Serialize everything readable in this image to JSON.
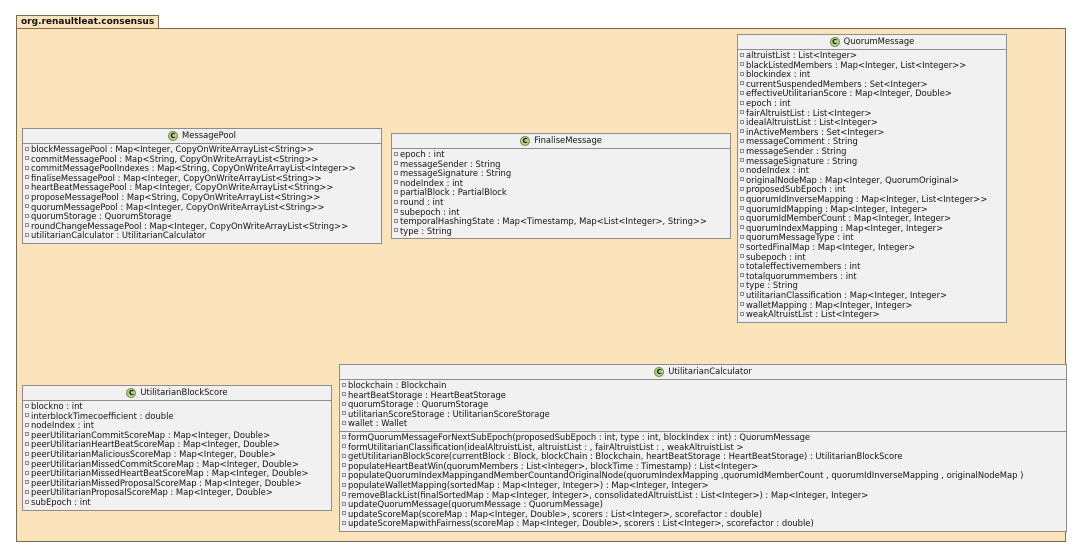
{
  "package": {
    "name": "org.renaultleat.consensus"
  },
  "classes": {
    "messagePool": {
      "stereotype": "C",
      "name": "MessagePool",
      "fields": [
        "blockMessagePool : Map<Integer, CopyOnWriteArrayList<String>>",
        "commitMessagePool : Map<String, CopyOnWriteArrayList<String>>",
        "commitMessagePoolIndexes : Map<String, CopyOnWriteArrayList<Integer>>",
        "finaliseMessagePool : Map<Integer, CopyOnWriteArrayList<String>>",
        "heartBeatMessagePool : Map<Integer, CopyOnWriteArrayList<String>>",
        "proposeMessagePool : Map<String, CopyOnWriteArrayList<String>>",
        "quorumMessagePool : Map<Integer, CopyOnWriteArrayList<String>>",
        "quorumStorage : QuorumStorage",
        "roundChangeMessagePool : Map<Integer, CopyOnWriteArrayList<String>>",
        "utilitarianCalculator : UtilitarianCalculator"
      ]
    },
    "finaliseMessage": {
      "stereotype": "C",
      "name": "FinaliseMessage",
      "fields": [
        "epoch : int",
        "messageSender : String",
        "messageSignature : String",
        "nodeIndex : int",
        "partialBlock : PartialBlock",
        "round : int",
        "subepoch : int",
        "temporalHashingState : Map<Timestamp, Map<List<Integer>, String>>",
        "type : String"
      ]
    },
    "quorumMessage": {
      "stereotype": "C",
      "name": "QuorumMessage",
      "fields": [
        "altruistList : List<Integer>",
        "blackListedMembers : Map<Integer, List<Integer>>",
        "blockindex : int",
        "currentSuspendedMembers : Set<Integer>",
        "effectiveUtilitarianScore : Map<Integer, Double>",
        "epoch : int",
        "fairAltruistList : List<Integer>",
        "idealAltruistList : List<Integer>",
        "inActiveMembers : Set<Integer>",
        "messageComment : String",
        "messageSender : String",
        "messageSignature : String",
        "nodeIndex : int",
        "originalNodeMap : Map<Integer, QuorumOriginal>",
        "proposedSubEpoch : int",
        "quorumIdInverseMapping : Map<Integer, List<Integer>>",
        "quorumIdMapping : Map<Integer, Integer>",
        "quorumIdMemberCount : Map<Integer, Integer>",
        "quorumIndexMapping : Map<Integer, Integer>",
        "quorumMessageType : int",
        "sortedFinalMap : Map<Integer, Integer>",
        "subepoch : int",
        "totaleffectivemembers : int",
        "totalquorummembers : int",
        "type : String",
        "utilitarianClassification : Map<Integer, Integer>",
        "walletMapping : Map<Integer, Integer>",
        "weakAltruistList : List<Integer>"
      ]
    },
    "utilitarianBlockScore": {
      "stereotype": "C",
      "name": "UtilitarianBlockScore",
      "fields": [
        "blockno : int",
        "interblockTimecoefficient : double",
        "nodeIndex : int",
        "peerUtilitarianCommitScoreMap : Map<Integer, Double>",
        "peerUtilitarianHeartBeatScoreMap : Map<Integer, Double>",
        "peerUtilitarianMaliciousScoreMap : Map<Integer, Double>",
        "peerUtilitarianMissedCommitScoreMap : Map<Integer, Double>",
        "peerUtilitarianMissedHeartBeatScoreMap : Map<Integer, Double>",
        "peerUtilitarianMissedProposalScoreMap : Map<Integer, Double>",
        "peerUtilitarianProposalScoreMap : Map<Integer, Double>",
        "subEpoch : int"
      ]
    },
    "utilitarianCalculator": {
      "stereotype": "C",
      "name": "UtilitarianCalculator",
      "fields": [
        "blockchain : Blockchain",
        "heartBeatStorage : HeartBeatStorage",
        "quorumStorage : QuorumStorage",
        "utilitarianScoreStorage : UtilitarianScoreStorage",
        "wallet : Wallet"
      ],
      "methods": [
        "formQuorumMessageForNextSubEpoch(proposedSubEpoch : int, type : int, blockIndex : int) : QuorumMessage",
        "formUtilitarianClassification(idealAltruistList, altruistList : , fairAltruistList : , weakAltruistList >",
        "getUtilitarianBlockScore(currentBlock : Block, blockChain : Blockchain, heartBeatStorage : HeartBeatStorage) : UtilitarianBlockScore",
        "populateHeartBeatWin(quorumMembers : List<Integer>, blockTime : Timestamp) : List<Integer>",
        "populateQuorumIndexMappingandMemberCountandOriginalNode(quorumIndexMapping ,quorumIdMemberCount , quorumIdInverseMapping , originalNodeMap )",
        "populateWalletMapping(sortedMap : Map<Integer, Integer>) : Map<Integer, Integer>",
        "removeBlackList(finalSortedMap : Map<Integer, Integer>, consolidatedAltruistList : List<Integer>) : Map<Integer, Integer>",
        "updateQuorumMessage(quorumMessage : QuorumMessage)",
        "updateScoreMap(scoreMap : Map<Integer, Double>, scorers : List<Integer>, scorefactor : double)",
        "updateScoreMapwithFairness(scoreMap : Map<Integer, Double>, scorers : List<Integer>, scorefactor : double)"
      ]
    }
  },
  "colors": {
    "package_fill": "#fbe4bb",
    "class_fill": "#f1f1f1",
    "class_icon": "#b9d18f",
    "border": "#8c8c8c"
  }
}
